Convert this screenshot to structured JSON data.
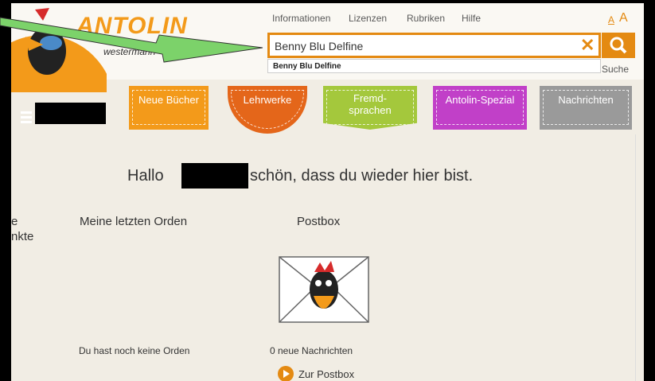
{
  "header": {
    "logo_text": "ANTOLIN",
    "logo_sub": "westermann",
    "nav": [
      "Informationen",
      "Lizenzen",
      "Rubriken",
      "Hilfe"
    ],
    "font_small": "A",
    "font_large": "A"
  },
  "search": {
    "value": "Benny Blu Delfine",
    "suggestion": "Benny Blu Delfine",
    "button_label": "Suche"
  },
  "categories": [
    {
      "label": "Neue Bücher",
      "color": "#f39a1a"
    },
    {
      "label": "Lehrwerke",
      "color": "#e4661a"
    },
    {
      "label": "Fremd-\nsprachen",
      "color": "#a4c83c"
    },
    {
      "label": "Antolin-Spezial",
      "color": "#c140c8"
    },
    {
      "label": "Nachrichten",
      "color": "#9a9a9a"
    }
  ],
  "main": {
    "greeting_start": "Hallo",
    "greeting_end": "schön, dass du wieder hier bist.",
    "left_line1": "e",
    "left_line2": "nkte",
    "orden_title": "Meine letzten Orden",
    "orden_empty": "Du hast noch keine Orden",
    "postbox_title": "Postbox",
    "postbox_count": "0 neue Nachrichten",
    "postbox_link": "Zur Postbox"
  },
  "colors": {
    "accent": "#e48a12",
    "arrow": "#7cd26a"
  }
}
